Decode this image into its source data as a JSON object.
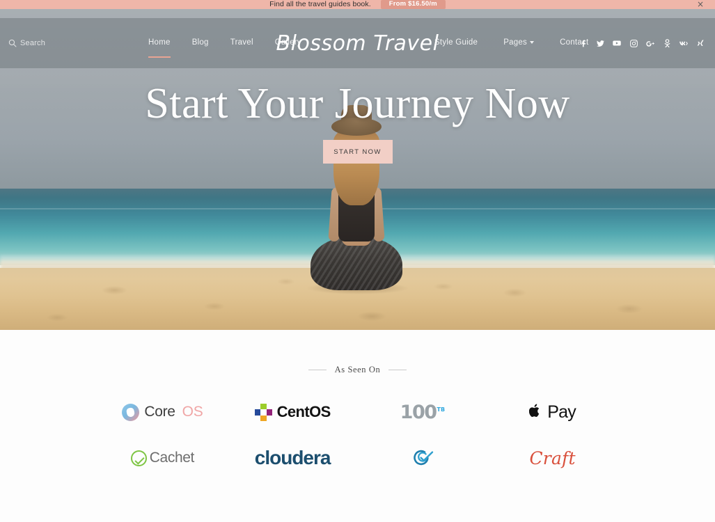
{
  "promo": {
    "text": "Find all the travel guides book.",
    "button_label": "From $16.50/m",
    "close_label": "×",
    "bg_color": "#efb6a9",
    "button_color": "#e09a8b"
  },
  "navbar": {
    "search_label": "Search",
    "logo": "Blossom Travel",
    "left_links": [
      {
        "label": "Home",
        "active": true
      },
      {
        "label": "Blog",
        "active": false
      },
      {
        "label": "Travel",
        "active": false
      },
      {
        "label": "Gallery",
        "active": false
      }
    ],
    "right_links": [
      {
        "label": "Style Guide",
        "has_caret": false
      },
      {
        "label": "Pages",
        "has_caret": true
      },
      {
        "label": "Contact",
        "has_caret": false
      }
    ],
    "socials": [
      "facebook-icon",
      "twitter-icon",
      "youtube-icon",
      "instagram-icon",
      "google-plus-icon",
      "odnoklassniki-icon",
      "vk-icon",
      "xing-icon"
    ],
    "active_underline_color": "#e8a493"
  },
  "hero": {
    "title": "Start Your Journey Now",
    "cta_label": "START NOW",
    "cta_bg": "#f2cfc6"
  },
  "seen_on": {
    "title": "As Seen On",
    "brands_row1": [
      {
        "name": "CoreOS",
        "text_dark": "Core",
        "text_light": "OS"
      },
      {
        "name": "CentOS",
        "text": "CentOS"
      },
      {
        "name": "100TB",
        "text": "100",
        "sup": "TB"
      },
      {
        "name": "Apple Pay",
        "glyph": "",
        "text": "Pay"
      }
    ],
    "brands_row2": [
      {
        "name": "Cachet",
        "text": "Cachet"
      },
      {
        "name": "Cloudera",
        "text": "cloudera"
      },
      {
        "name": "Checkmarx",
        "text": ""
      },
      {
        "name": "Craft",
        "text": "Craft"
      }
    ]
  }
}
